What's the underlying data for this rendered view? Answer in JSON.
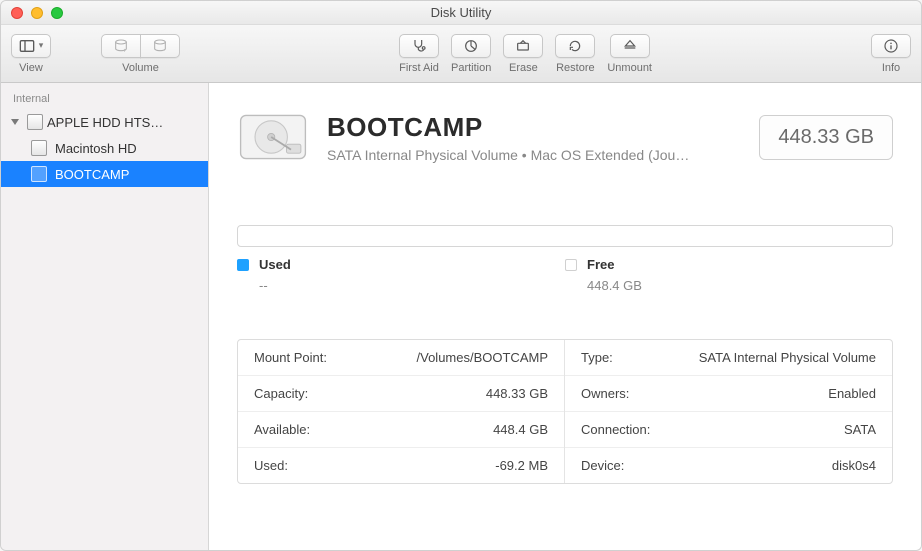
{
  "window": {
    "title": "Disk Utility"
  },
  "toolbar": {
    "view_label": "View",
    "volume_label": "Volume",
    "firstaid_label": "First Aid",
    "partition_label": "Partition",
    "erase_label": "Erase",
    "restore_label": "Restore",
    "unmount_label": "Unmount",
    "info_label": "Info"
  },
  "sidebar": {
    "section": "Internal",
    "parent": "APPLE HDD HTS…",
    "child1": "Macintosh HD",
    "child2": "BOOTCAMP"
  },
  "volume": {
    "name": "BOOTCAMP",
    "subtitle": "SATA Internal Physical Volume • Mac OS Extended (Jou…",
    "size_badge": "448.33 GB"
  },
  "legend": {
    "used_label": "Used",
    "used_value": "--",
    "free_label": "Free",
    "free_value": "448.4 GB"
  },
  "info_left": [
    {
      "k": "Mount Point:",
      "v": "/Volumes/BOOTCAMP"
    },
    {
      "k": "Capacity:",
      "v": "448.33 GB"
    },
    {
      "k": "Available:",
      "v": "448.4 GB"
    },
    {
      "k": "Used:",
      "v": "-69.2 MB"
    }
  ],
  "info_right": [
    {
      "k": "Type:",
      "v": "SATA Internal Physical Volume"
    },
    {
      "k": "Owners:",
      "v": "Enabled"
    },
    {
      "k": "Connection:",
      "v": "SATA"
    },
    {
      "k": "Device:",
      "v": "disk0s4"
    }
  ]
}
